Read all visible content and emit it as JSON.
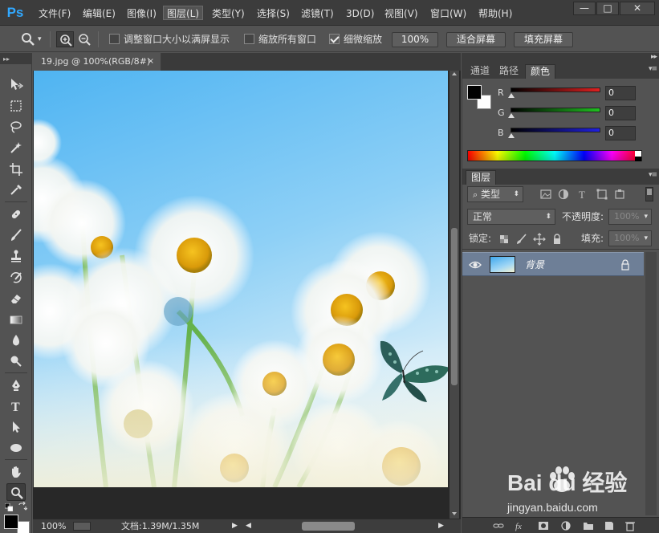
{
  "app": {
    "logo": "Ps"
  },
  "menu": [
    {
      "label": "文件(F)",
      "active": false
    },
    {
      "label": "编辑(E)",
      "active": false
    },
    {
      "label": "图像(I)",
      "active": false
    },
    {
      "label": "图层(L)",
      "active": true
    },
    {
      "label": "类型(Y)",
      "active": false
    },
    {
      "label": "选择(S)",
      "active": false
    },
    {
      "label": "滤镜(T)",
      "active": false
    },
    {
      "label": "3D(D)",
      "active": false
    },
    {
      "label": "视图(V)",
      "active": false
    },
    {
      "label": "窗口(W)",
      "active": false
    },
    {
      "label": "帮助(H)",
      "active": false
    }
  ],
  "window_controls": {
    "minimize": "—",
    "restore": "□",
    "close": "✕"
  },
  "options": {
    "resize_windows_label": "调整窗口大小以满屏显示",
    "resize_windows_checked": false,
    "zoom_all_label": "缩放所有窗口",
    "zoom_all_checked": false,
    "scrubby_zoom_label": "细微缩放",
    "scrubby_zoom_checked": true,
    "btn_100": "100%",
    "btn_fit": "适合屏幕",
    "btn_fill": "填充屏幕"
  },
  "document": {
    "tab_title": "19.jpg @ 100%(RGB/8#)",
    "tab_close": "×",
    "zoom": "100%",
    "doc_info": "文档:1.39M/1.35M"
  },
  "color_panel": {
    "tabs": [
      "通道",
      "路径",
      "颜色"
    ],
    "active_tab": 2,
    "r_label": "R",
    "r_value": "0",
    "g_label": "G",
    "g_value": "0",
    "b_label": "B",
    "b_value": "0",
    "colors": {
      "r": "#e02020",
      "g": "#20c020",
      "b": "#2020e0"
    }
  },
  "layers_panel": {
    "tab": "图层",
    "filter_label": "类型",
    "blend_mode": "正常",
    "opacity_label": "不透明度:",
    "opacity_value": "100%",
    "lock_label": "锁定:",
    "fill_label": "填充:",
    "fill_value": "100%",
    "layers": [
      {
        "name": "背景",
        "visible": true,
        "locked": true
      }
    ]
  },
  "watermark": {
    "brand": "Bai du 经验",
    "url": "jingyan.baidu.com"
  }
}
